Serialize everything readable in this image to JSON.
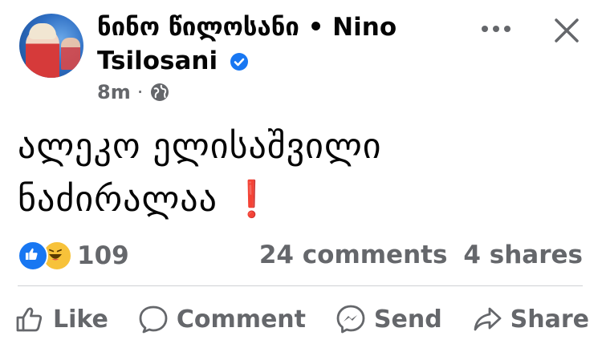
{
  "post": {
    "author_name": "ნინო წილოსანი • Nino Tsilosani",
    "verified": true,
    "timestamp": "8m",
    "separator": "·",
    "privacy_icon": "globe-icon",
    "text_line1": "ალეკო ელისაშვილი",
    "text_line2": "ნაძირალაა",
    "text_emoji": "❗"
  },
  "header": {
    "more_icon": "more-options-icon",
    "close_icon": "close-icon"
  },
  "stats": {
    "reaction_icons": [
      "like-reaction-icon",
      "haha-reaction-icon"
    ],
    "reaction_count": "109",
    "comments": "24 comments",
    "shares": "4 shares"
  },
  "actions": {
    "like_label": "Like",
    "comment_label": "Comment",
    "send_label": "Send",
    "share_label": "Share"
  },
  "colors": {
    "text": "#050505",
    "muted": "#65676b",
    "brand_blue": "#1877f2",
    "divider": "#ced0d4",
    "exclamation": "#e3242b"
  }
}
